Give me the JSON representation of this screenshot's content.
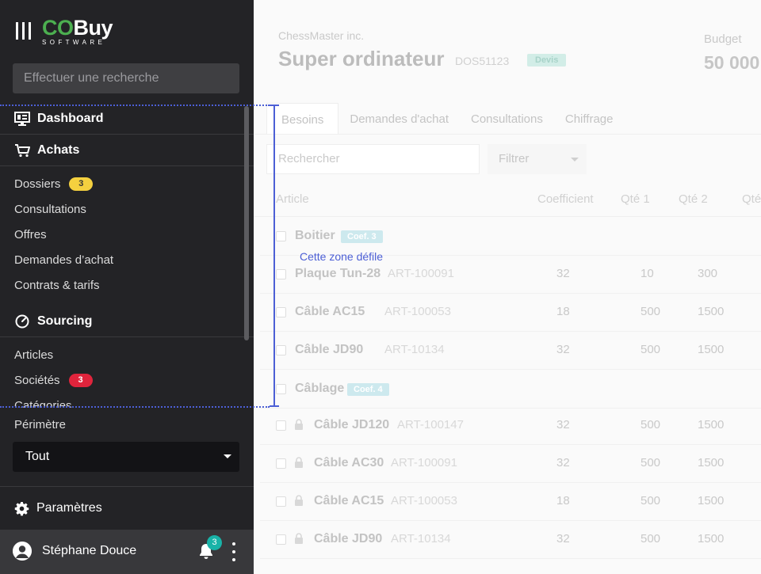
{
  "brand": {
    "name_a": "CO",
    "name_b": "Buy",
    "tagline": "SOFTWARE"
  },
  "search": {
    "placeholder": "Effectuer une recherche"
  },
  "nav": {
    "dashboard": "Dashboard",
    "achats": {
      "title": "Achats",
      "items": [
        {
          "label": "Dossiers",
          "badge": "3"
        },
        {
          "label": "Consultations"
        },
        {
          "label": "Offres"
        },
        {
          "label": "Demandes d’achat"
        },
        {
          "label": "Contrats & tarifs"
        }
      ]
    },
    "sourcing": {
      "title": "Sourcing",
      "items": [
        {
          "label": "Articles"
        },
        {
          "label": "Sociétés",
          "badge": "3"
        },
        {
          "label": "Catégories"
        }
      ]
    }
  },
  "perimetre": {
    "label": "Périmètre",
    "value": "Tout"
  },
  "settings": {
    "label": "Paramètres"
  },
  "user": {
    "name": "Stéphane Douce",
    "notifications": "3"
  },
  "annotation": {
    "label": "Cette zone défile"
  },
  "colors": {
    "accent": "#4c5fd5",
    "brand_green": "#4caf50",
    "sidebar_bg": "#232326",
    "badge_yellow": "#f4d03f",
    "badge_red": "#e0243c",
    "teal": "#19b3a8"
  },
  "main": {
    "company": "ChessMaster inc.",
    "title": "Super ordinateur",
    "ref": "DOS51123",
    "status": "Devis",
    "budget_label": "Budget",
    "budget_value": "50 000",
    "tabs": [
      "Besoins",
      "Demandes d'achat",
      "Consultations",
      "Chiffrage"
    ],
    "search_placeholder": "Rechercher",
    "filter_label": "Filtrer",
    "columns": [
      "Article",
      "Coefficient",
      "Qté 1",
      "Qté 2",
      "Qté"
    ],
    "groups": [
      {
        "name": "Boitier",
        "coef": "Coef. 3",
        "rows": [
          {
            "name": "Plaque Tun-28",
            "code": "ART-100091",
            "coef": "32",
            "q1": "10",
            "q2": "300"
          },
          {
            "name": "Câble AC15",
            "code": "ART-100053",
            "coef": "18",
            "q1": "500",
            "q2": "1500"
          },
          {
            "name": "Câble JD90",
            "code": "ART-10134",
            "coef": "32",
            "q1": "500",
            "q2": "1500"
          }
        ]
      },
      {
        "name": "Câblage",
        "coef": "Coef. 4",
        "rows": [
          {
            "name": "Câble JD120",
            "code": "ART-100147",
            "coef": "32",
            "q1": "500",
            "q2": "1500"
          },
          {
            "name": "Câble AC30",
            "code": "ART-100091",
            "coef": "32",
            "q1": "500",
            "q2": "1500"
          },
          {
            "name": "Câble AC15",
            "code": "ART-100053",
            "coef": "18",
            "q1": "500",
            "q2": "1500"
          },
          {
            "name": "Câble JD90",
            "code": "ART-10134",
            "coef": "32",
            "q1": "500",
            "q2": "1500"
          }
        ]
      }
    ]
  }
}
